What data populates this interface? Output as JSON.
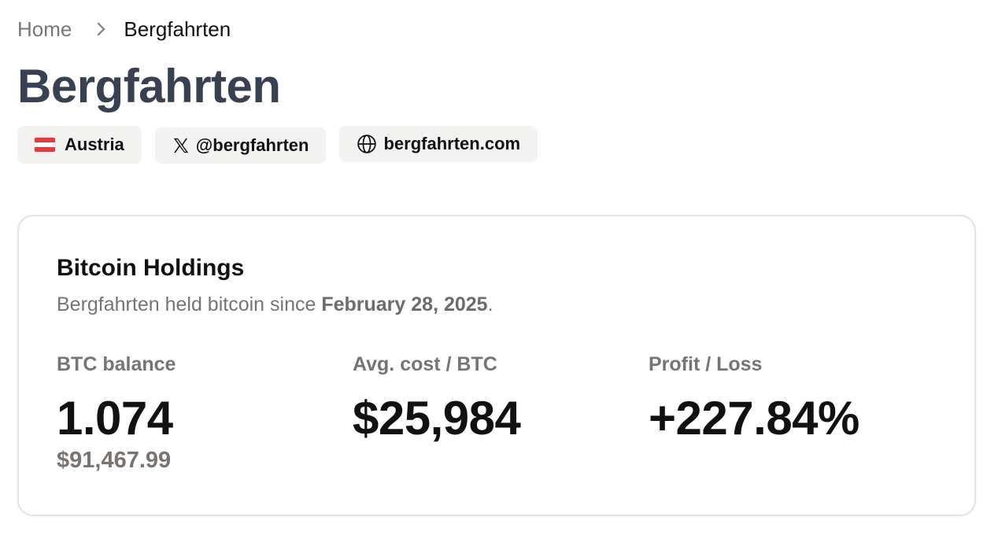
{
  "breadcrumb": {
    "home": "Home",
    "current": "Bergfahrten"
  },
  "page_title": "Bergfahrten",
  "chips": {
    "country": {
      "label": "Austria",
      "icon": "austria-flag-icon"
    },
    "twitter": {
      "label": "@bergfahrten",
      "icon": "x-logo-icon"
    },
    "website": {
      "label": "bergfahrten.com",
      "icon": "globe-icon"
    }
  },
  "holdings": {
    "title": "Bitcoin Holdings",
    "subtitle_prefix": "Bergfahrten held bitcoin since ",
    "subtitle_date": "February 28, 2025",
    "subtitle_suffix": ".",
    "stats": {
      "balance": {
        "label": "BTC balance",
        "value": "1.074",
        "sub": "$91,467.99"
      },
      "avg_cost": {
        "label": "Avg. cost / BTC",
        "value": "$25,984"
      },
      "profit": {
        "label": "Profit / Loss",
        "value": "+227.84%"
      }
    }
  },
  "colors": {
    "title": "#374151",
    "muted": "#777471",
    "chip_bg": "#f3f3f2",
    "card_border": "#e3e3e3"
  }
}
